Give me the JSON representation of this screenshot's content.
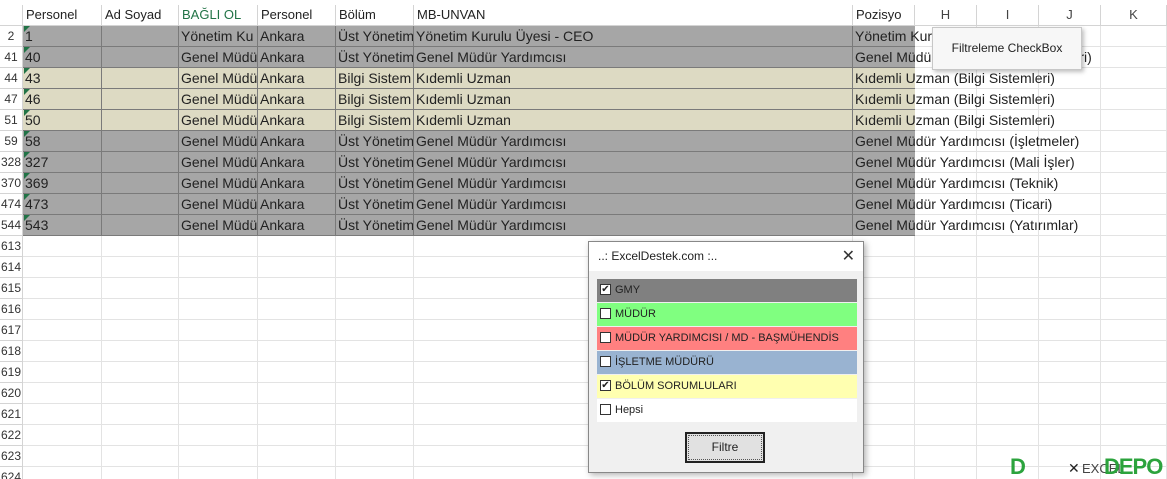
{
  "headers": [
    {
      "label": "Personel",
      "filter": true
    },
    {
      "label": "Ad Soyad",
      "filter": true
    },
    {
      "label": "BAĞLI OL",
      "filter": true
    },
    {
      "label": "Personel",
      "filter": true
    },
    {
      "label": "Bölüm",
      "filter": true
    },
    {
      "label": "MB-UNVAN",
      "filter": true
    },
    {
      "label": "Pozisyo",
      "filter": true
    },
    {
      "label": "H",
      "filter": false
    },
    {
      "label": "I",
      "filter": false
    },
    {
      "label": "J",
      "filter": false
    },
    {
      "label": "K",
      "filter": false
    }
  ],
  "rows": [
    {
      "num": "2",
      "color": "gray",
      "cells": [
        "1",
        "",
        "Yönetim Ku",
        "Ankara",
        "Üst Yönetim",
        "Yönetim Kurulu Üyesi - CEO",
        "Yönetim Kurulu Üyesi (Yönetim)"
      ]
    },
    {
      "num": "41",
      "color": "gray",
      "cells": [
        "40",
        "",
        "Genel Müdü",
        "Ankara",
        "Üst Yönetim",
        "Genel Müdür Yardımcısı",
        "Genel Müdür Yardımcısı (Teknolojileri)"
      ]
    },
    {
      "num": "44",
      "color": "beige",
      "cells": [
        "43",
        "",
        "Genel Müdü",
        "Ankara",
        "Bilgi Sistem",
        "Kıdemli Uzman",
        "Kıdemli Uzman (Bilgi Sistemleri)"
      ]
    },
    {
      "num": "47",
      "color": "beige",
      "cells": [
        "46",
        "",
        "Genel Müdü",
        "Ankara",
        "Bilgi Sistem",
        "Kıdemli Uzman",
        "Kıdemli Uzman (Bilgi Sistemleri)"
      ]
    },
    {
      "num": "51",
      "color": "beige",
      "cells": [
        "50",
        "",
        "Genel Müdü",
        "Ankara",
        "Bilgi Sistem",
        "Kıdemli Uzman",
        "Kıdemli Uzman (Bilgi Sistemleri)"
      ]
    },
    {
      "num": "59",
      "color": "gray",
      "cells": [
        "58",
        "",
        "Genel Müdü",
        "Ankara",
        "Üst Yönetim",
        "Genel Müdür Yardımcısı",
        "Genel Müdür Yardımcısı (İşletmeler)"
      ]
    },
    {
      "num": "328",
      "color": "gray",
      "cells": [
        "327",
        "",
        "Genel Müdü",
        "Ankara",
        "Üst Yönetim",
        "Genel Müdür Yardımcısı",
        "Genel Müdür Yardımcısı (Mali İşler)"
      ]
    },
    {
      "num": "370",
      "color": "gray",
      "cells": [
        "369",
        "",
        "Genel Müdü",
        "Ankara",
        "Üst Yönetim",
        "Genel Müdür Yardımcısı",
        "Genel Müdür Yardımcısı (Teknik)"
      ]
    },
    {
      "num": "474",
      "color": "gray",
      "cells": [
        "473",
        "",
        "Genel Müdü",
        "Ankara",
        "Üst Yönetim",
        "Genel Müdür Yardımcısı",
        "Genel Müdür Yardımcısı (Ticari)"
      ]
    },
    {
      "num": "544",
      "color": "gray",
      "cells": [
        "543",
        "",
        "Genel Müdü",
        "Ankara",
        "Üst Yönetim",
        "Genel Müdür Yardımcısı",
        "Genel Müdür Yardımcısı (Yatırımlar)"
      ]
    }
  ],
  "empty_rows": [
    "613",
    "614",
    "615",
    "616",
    "617",
    "618",
    "619",
    "620",
    "621",
    "622",
    "623",
    "624"
  ],
  "tooltip": "Filtreleme CheckBox",
  "dialog": {
    "title": "..: ExcelDestek.com :..",
    "close": "✕",
    "options": [
      {
        "label": "GMY",
        "checked": true,
        "color": "#808080"
      },
      {
        "label": "MÜDÜR",
        "checked": false,
        "color": "#80ff80"
      },
      {
        "label": "MÜDÜR YARDIMCISI / MD - BAŞMÜHENDİS",
        "checked": false,
        "color": "#ff8080"
      },
      {
        "label": "İŞLETME MÜDÜRÜ",
        "checked": false,
        "color": "#99b3d1"
      },
      {
        "label": "BÖLÜM SORUMLULARI",
        "checked": true,
        "color": "#ffffb0"
      },
      {
        "label": "Hepsi",
        "checked": false,
        "color": "#ffffff"
      }
    ],
    "button": "Filtre"
  },
  "watermark": {
    "d": "D",
    "x": "✕",
    "excel": "EXCEL",
    "depo": "DEPO"
  }
}
